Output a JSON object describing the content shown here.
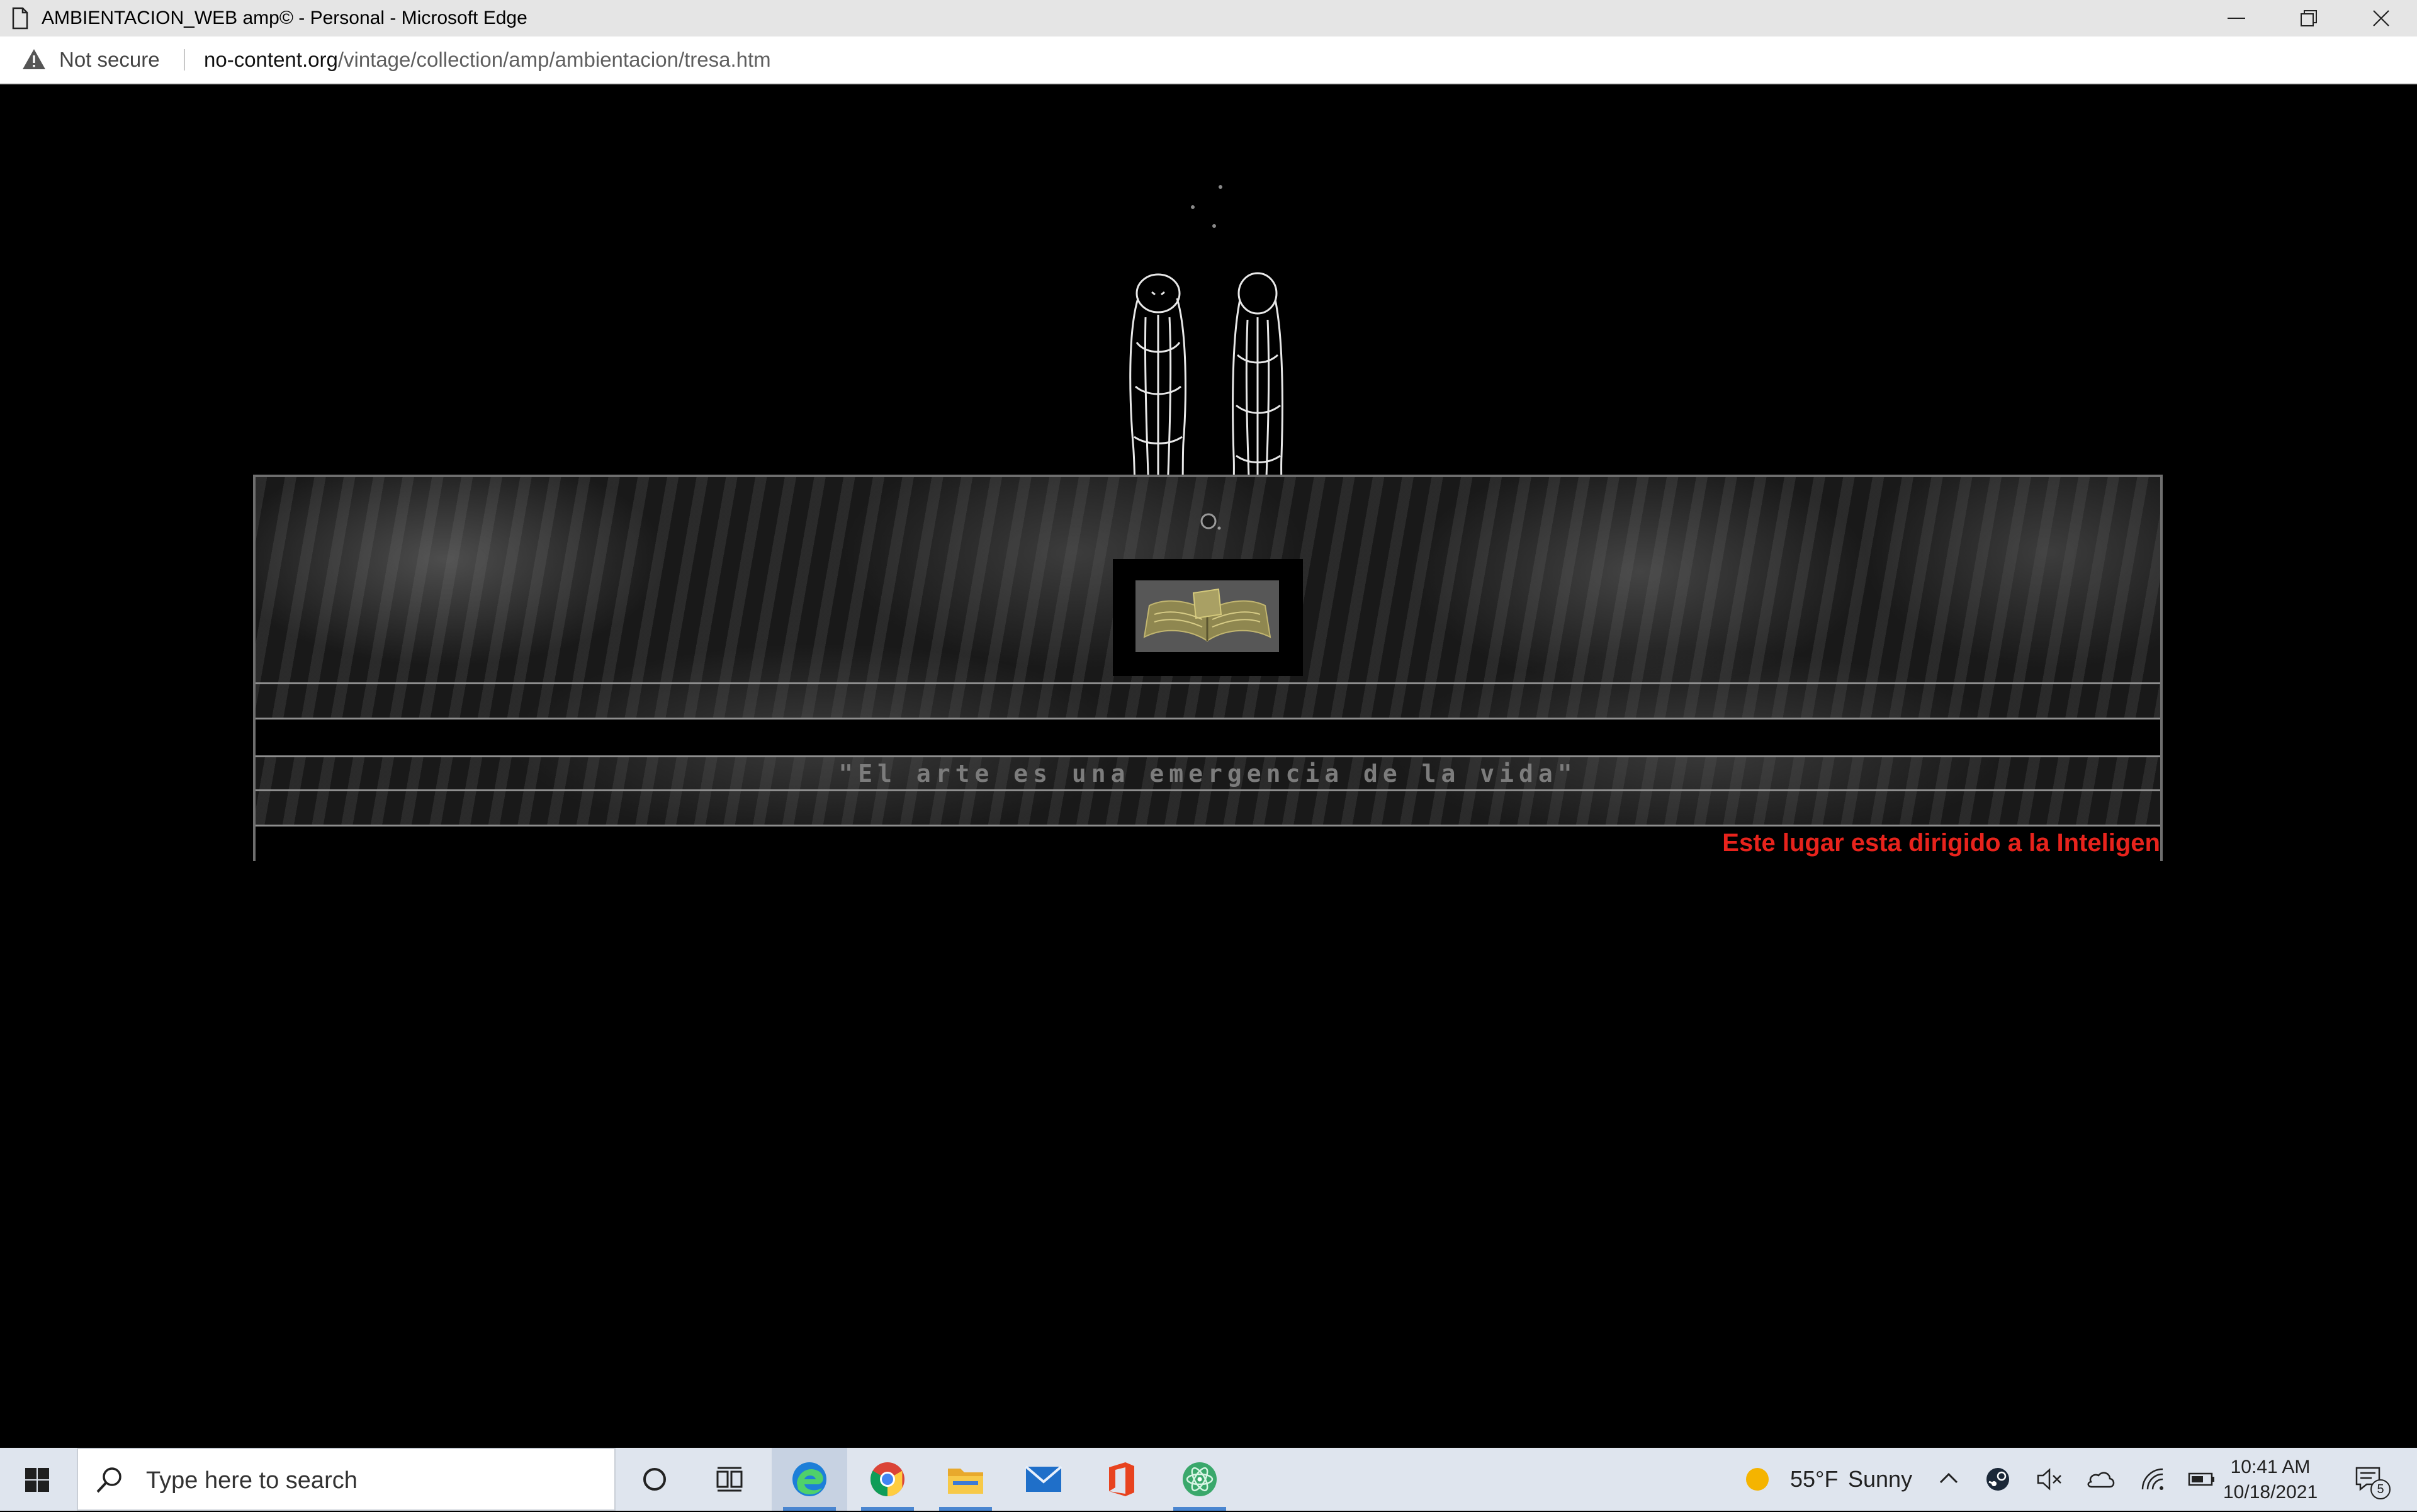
{
  "window": {
    "title": "AMBIENTACION_WEB amp© - Personal - Microsoft Edge"
  },
  "addressbar": {
    "security_label": "Not secure",
    "url_host": "no-content.org",
    "url_path": "/vintage/collection/amp/ambientacion/tresa.htm"
  },
  "page": {
    "motto": "\"El arte es una emergencia de la vida\"",
    "marquee_text": "Este lugar esta dirigido a la Inteligen",
    "colors": {
      "background": "#000000",
      "marquee": "#e8231c",
      "motto": "#7c7c7c"
    }
  },
  "taskbar": {
    "search_placeholder": "Type here to search",
    "apps": [
      "cortana-icon",
      "task-view-icon",
      "edge-icon",
      "chrome-icon",
      "file-explorer-icon",
      "mail-icon",
      "office-icon",
      "atom-icon"
    ],
    "weather_temp": "55°F",
    "weather_condition": "Sunny",
    "time": "10:41 AM",
    "date": "10/18/2021",
    "notification_count": "5"
  }
}
